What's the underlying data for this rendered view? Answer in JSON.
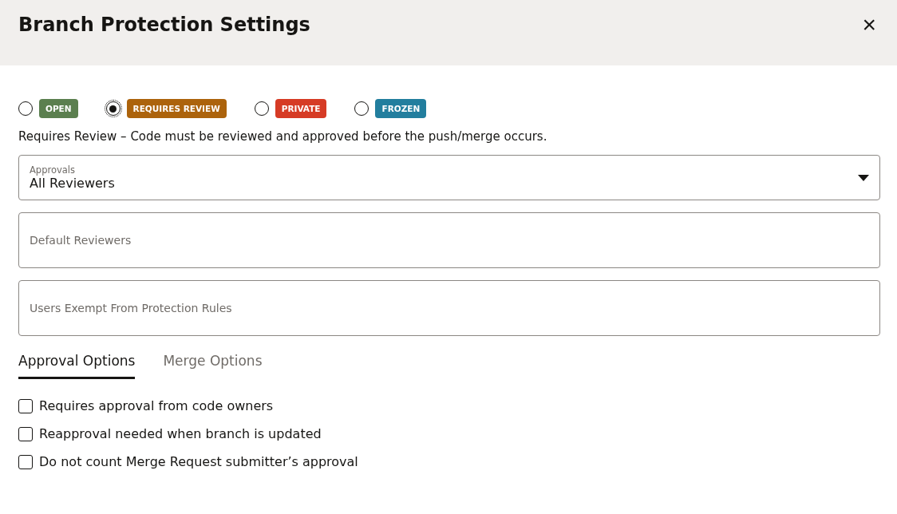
{
  "dialog": {
    "title": "Branch Protection Settings",
    "close": "×"
  },
  "protection_levels": [
    {
      "label": "OPEN",
      "selected": false,
      "color": "#5b7f4f"
    },
    {
      "label": "REQUIRES REVIEW",
      "selected": true,
      "color": "#ac630c"
    },
    {
      "label": "PRIVATE",
      "selected": false,
      "color": "#d63b25"
    },
    {
      "label": "FROZEN",
      "selected": false,
      "color": "#227e9e"
    }
  ],
  "description": "Requires Review – Code must be reviewed and approved before the push/merge occurs.",
  "approvals_select": {
    "label": "Approvals",
    "value": "All Reviewers"
  },
  "fields": [
    {
      "placeholder": "Default Reviewers"
    },
    {
      "placeholder": "Users Exempt From Protection Rules"
    }
  ],
  "tabs": [
    {
      "label": "Approval Options",
      "selected": true
    },
    {
      "label": "Merge Options",
      "selected": false
    }
  ],
  "options": [
    {
      "label": "Requires approval from code owners",
      "checked": false
    },
    {
      "label": "Reapproval needed when branch is updated",
      "checked": false
    },
    {
      "label": "Do not count Merge Request submitter’s approval",
      "checked": false
    }
  ]
}
